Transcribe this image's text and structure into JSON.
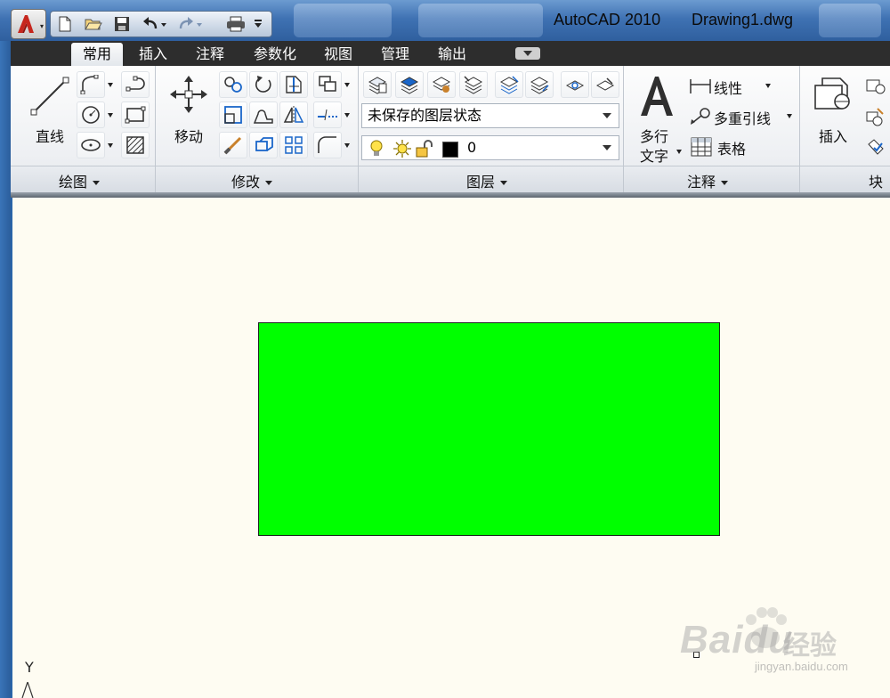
{
  "window": {
    "app_title": "AutoCAD 2010",
    "doc_title": "Drawing1.dwg"
  },
  "quick_access": {
    "items": [
      "new-icon",
      "open-icon",
      "save-icon",
      "undo-icon",
      "redo-icon",
      "print-icon",
      "customize-icon"
    ]
  },
  "tabs": [
    {
      "label": "常用",
      "active": true
    },
    {
      "label": "插入",
      "active": false
    },
    {
      "label": "注释",
      "active": false
    },
    {
      "label": "参数化",
      "active": false
    },
    {
      "label": "视图",
      "active": false
    },
    {
      "label": "管理",
      "active": false
    },
    {
      "label": "输出",
      "active": false
    }
  ],
  "panels": {
    "draw": {
      "title": "绘图",
      "line_label": "直线"
    },
    "modify": {
      "title": "修改",
      "move_label": "移动"
    },
    "layers": {
      "title": "图层",
      "layer_state": "未保存的图层状态",
      "current_layer": "0",
      "layer_color": "#000000"
    },
    "annotation": {
      "title": "注释",
      "mtext_line1": "多行",
      "mtext_line2": "文字",
      "linear_label": "线性",
      "multileader_label": "多重引线",
      "table_label": "表格"
    },
    "block": {
      "title": "块",
      "insert_label": "插入"
    }
  },
  "drawing": {
    "shape": "rectangle",
    "fill_color": "#00ff00",
    "background": "#fefcf2",
    "ucs_label": "Y"
  },
  "watermark": {
    "brand": "Bai",
    "brand2": "du",
    "cn": "经验",
    "url": "jingyan.baidu.com"
  }
}
